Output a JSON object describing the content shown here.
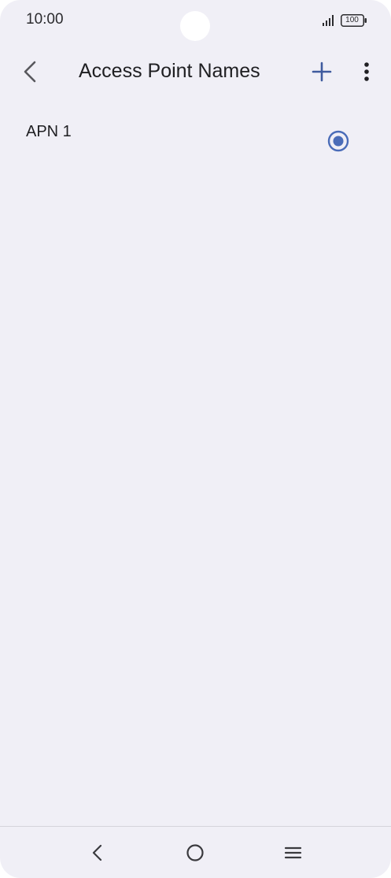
{
  "status_bar": {
    "time": "10:00",
    "battery_level": "100",
    "icons": [
      "signal-icon",
      "battery-icon"
    ]
  },
  "app_bar": {
    "title": "Access Point Names",
    "back_icon": "chevron-left-icon",
    "add_icon": "plus-icon",
    "more_icon": "more-vertical-icon"
  },
  "apn_list": [
    {
      "name": "APN 1",
      "selected": true
    }
  ],
  "nav_bar": {
    "icons": [
      "nav-back-icon",
      "nav-home-icon",
      "nav-recents-icon"
    ]
  },
  "colors": {
    "background": "#f0eff6",
    "accent": "#4a6cb8",
    "text": "#1f1f22"
  }
}
